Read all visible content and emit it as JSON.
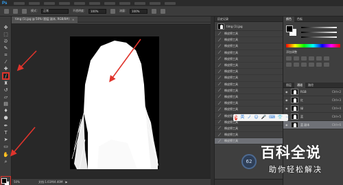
{
  "app": {
    "logo": "Ps"
  },
  "options_bar": {
    "mode_label": "模式：",
    "mode_value": "正常",
    "opacity_label": "不透明度：",
    "opacity_value": "100%",
    "flow_label": "流量：",
    "flow_value": "100%"
  },
  "document": {
    "tab_label": "timg (1).jpg @ 50% (图层 副本, RGB/8#)",
    "close_glyph": "×"
  },
  "status_bar": {
    "zoom": "50%",
    "doc_size": "文档:1.61M/4.40M",
    "arrow": "▶"
  },
  "history": {
    "title": "历史记录",
    "snapshot_name": "timg (1).jpg",
    "step_label": "橡皮擦工具",
    "step_count": 18,
    "selected_index": 17
  },
  "right_panel": {
    "color_tabs": [
      "颜色",
      "色板"
    ],
    "adjust_title": "添加调整",
    "layer_tabs": [
      "图层",
      "通道",
      "路径"
    ],
    "channels": [
      {
        "name": "RGB",
        "shortcut": "Ctrl+2"
      },
      {
        "name": "红",
        "shortcut": "Ctrl+3"
      },
      {
        "name": "绿",
        "shortcut": "Ctrl+4"
      },
      {
        "name": "蓝",
        "shortcut": "Ctrl+5"
      },
      {
        "name": "蓝 副本",
        "shortcut": "Ctrl+6"
      }
    ],
    "selected_channel": 4
  },
  "ime_toolbar": {
    "logo": "S",
    "items": [
      "英",
      "ノ",
      "☺",
      "🎤",
      "⌨",
      "👕",
      "⋯"
    ]
  },
  "gauge": {
    "value": "62"
  },
  "watermark": {
    "brand": "百科全说",
    "slogan": "助你轻松解决"
  },
  "colors": {
    "accent_red": "#e0342c",
    "selected_row": "#6f7177"
  },
  "icons": [
    "move-icon",
    "marquee-icon",
    "lasso-icon",
    "quick-select-icon",
    "crop-icon",
    "eyedropper-icon",
    "healing-brush-icon",
    "brush-icon",
    "clone-stamp-icon",
    "history-brush-icon",
    "eraser-icon",
    "gradient-icon",
    "blur-icon",
    "dodge-icon",
    "pen-icon",
    "type-icon",
    "path-select-icon",
    "shape-icon",
    "hand-icon",
    "zoom-icon"
  ]
}
